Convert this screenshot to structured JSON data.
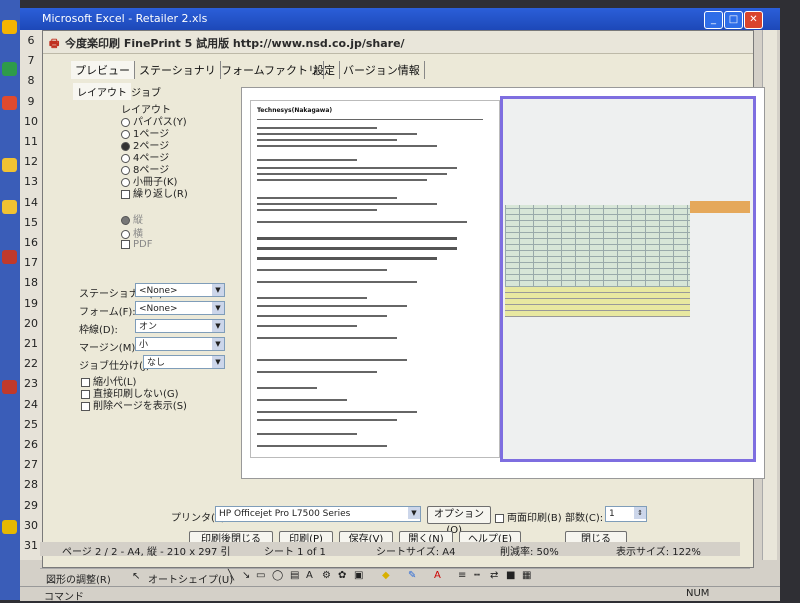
{
  "excel": {
    "title": "Microsoft Excel - Retailer 2.xls",
    "row_numbers": [
      "6",
      "7",
      "8",
      "9",
      "10",
      "11",
      "12",
      "13",
      "14",
      "15",
      "16",
      "17",
      "18",
      "19",
      "20",
      "21",
      "22",
      "23",
      "24",
      "25",
      "26",
      "27",
      "28",
      "29",
      "30",
      "31"
    ]
  },
  "dialog": {
    "title": "今度楽印刷 FinePrint 5 試用版 http://www.nsd.co.jp/share/",
    "tabs": [
      "プレビュー",
      "ステーショナリ",
      "フォームファクトリ",
      "設定",
      "バージョン情報"
    ],
    "subtabs": [
      "レイアウト",
      "ジョブ"
    ],
    "layout_group": "レイアウト",
    "layout_options": [
      "パイパス(Y)",
      "1ページ",
      "2ページ",
      "4ページ",
      "8ページ",
      "小冊子(K)",
      "繰り返し(R)"
    ],
    "layout_selected": "2ページ",
    "orientation_options": [
      "縦",
      "横",
      "PDF"
    ],
    "orientation_selected": "縦",
    "fields": [
      {
        "label": "ステーショナリ(E):",
        "value": "<None>"
      },
      {
        "label": "フォーム(F):",
        "value": "<None>"
      },
      {
        "label": "枠線(D):",
        "value": "オン"
      },
      {
        "label": "マージン(M):",
        "value": "小"
      },
      {
        "label": "ジョブ仕分け(J):",
        "value": "なし"
      }
    ],
    "checkboxes": [
      "縮小代(L)",
      "直接印刷しない(G)",
      "削除ページを表示(S)"
    ],
    "printer_label": "プリンタ(T):",
    "printer_value": "HP Officejet Pro L7500 Series",
    "options_button": "オプション(O)...",
    "duplex_label": "両面印刷(B)",
    "copies_label": "部数(C):",
    "copies_value": "1",
    "buttons": [
      "印刷後閉じる",
      "印刷(P)",
      "保存(V)",
      "開く(N)",
      "ヘルプ(E)",
      "閉じる"
    ]
  },
  "preview": {
    "left_page_title": "Technesys(Nakagawa)"
  },
  "status": {
    "page": "ページ 2 / 2 - A4, 縦 - 210 x 297 引",
    "sheet": "シート 1 of 1",
    "size": "シートサイズ: A4",
    "zoom": "削減率: 50%",
    "display": "表示サイズ: 122%"
  },
  "drawbar": {
    "label": "図形の調整(R)",
    "autoshape": "オートシェイプ(U)"
  },
  "cmdbar": {
    "mode": "コマンド",
    "num": "NUM"
  }
}
